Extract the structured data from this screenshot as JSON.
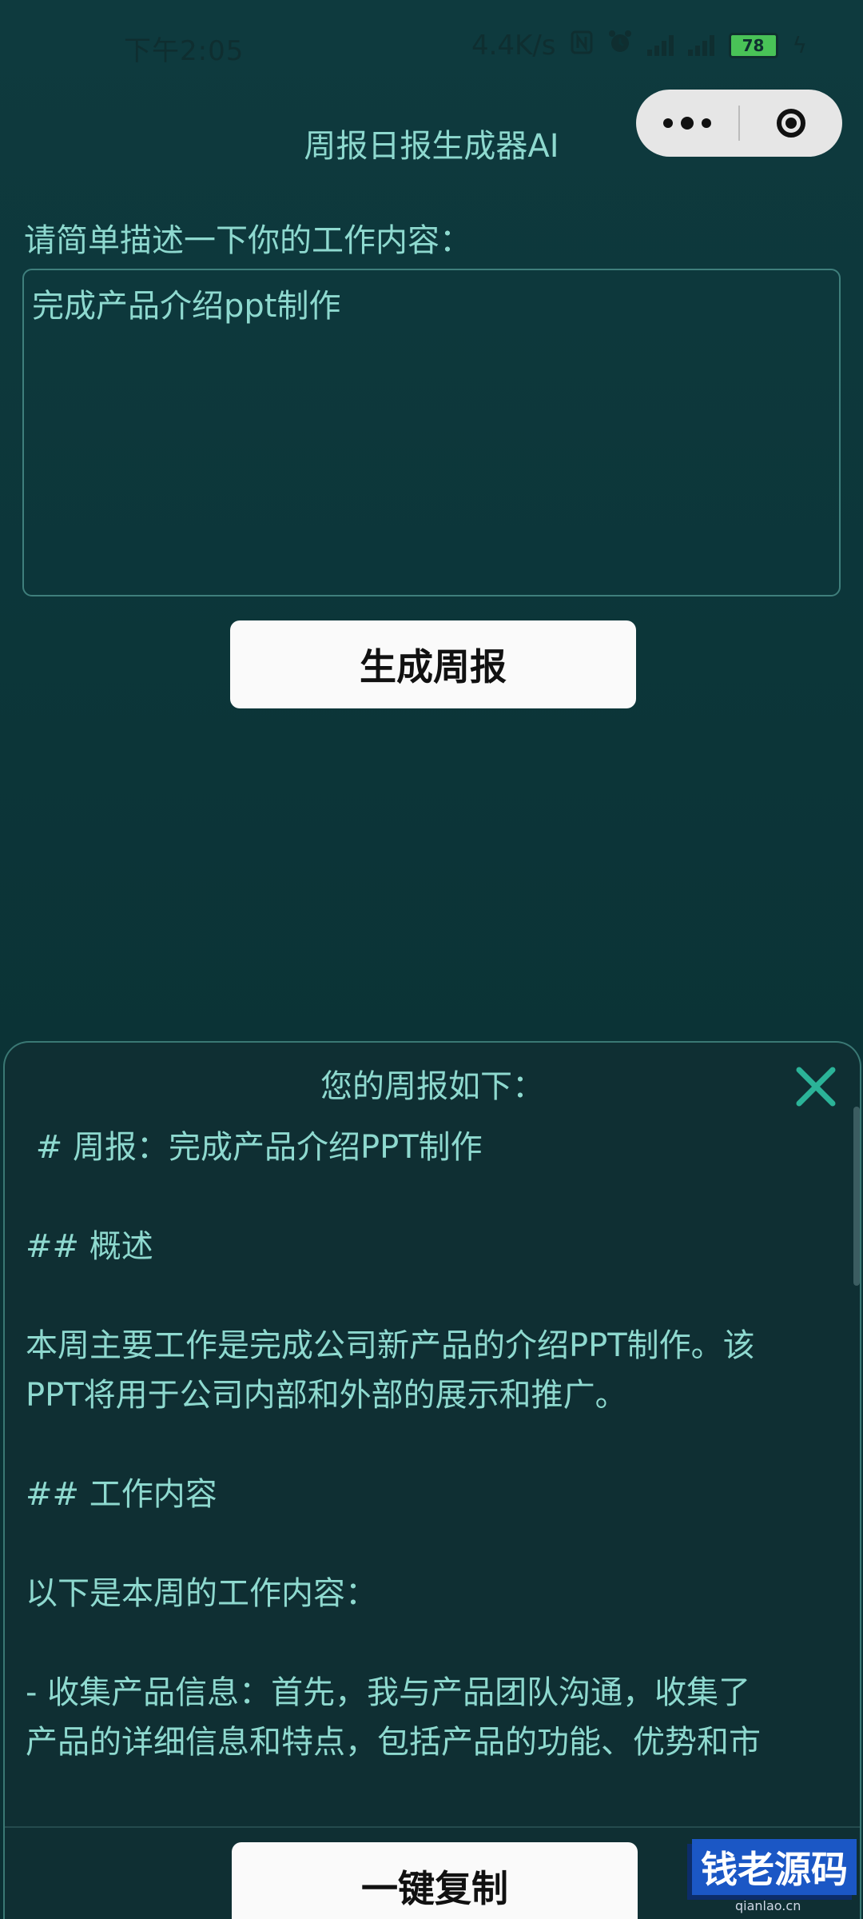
{
  "status_bar": {
    "time": "下午2:05",
    "speed": "4.4K/s",
    "battery": "78"
  },
  "page": {
    "title": "周报日报生成器AI"
  },
  "form": {
    "prompt_label": "请简单描述一下你的工作内容：",
    "input_value": "完成产品介绍ppt制作",
    "generate_label": "生成周报"
  },
  "result": {
    "title": "您的周报如下：",
    "lines": [
      " # 周报：完成产品介绍PPT制作",
      "",
      "## 概述",
      "",
      "本周主要工作是完成公司新产品的介绍PPT制作。该",
      "PPT将用于公司内部和外部的展示和推广。",
      "",
      "## 工作内容",
      "",
      "以下是本周的工作内容：",
      "",
      "- 收集产品信息：首先，我与产品团队沟通，收集了",
      "产品的详细信息和特点，包括产品的功能、优势和市"
    ],
    "copy_label": "一键复制"
  },
  "watermark": {
    "text": "钱老源码",
    "sub": "qianlao.cn"
  },
  "colors": {
    "accent_text": "#8ed9cf",
    "close_icon": "#2bb398"
  }
}
